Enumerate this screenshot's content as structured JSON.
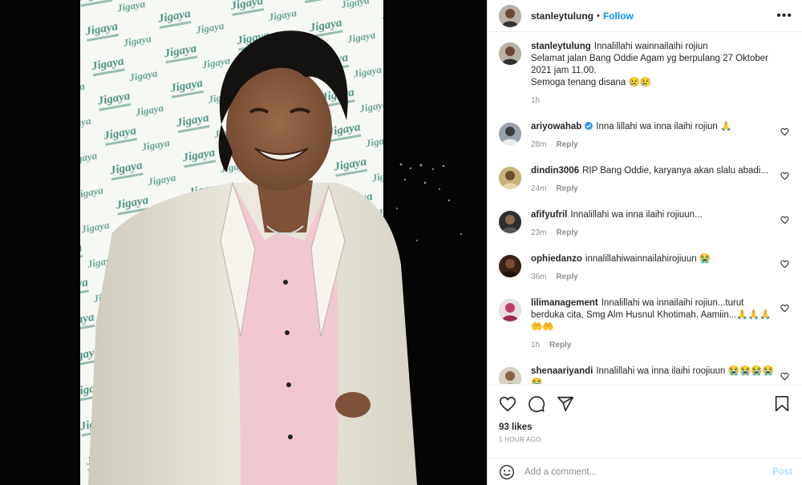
{
  "header": {
    "username": "stanleytulung",
    "separator": "•",
    "follow_label": "Follow",
    "more_label": "•••"
  },
  "caption": {
    "username": "stanleytulung",
    "text": "Innalillahi wainnailaihi rojiun\nSelamat jalan Bang Oddie Agam yg berpulang 27 Oktober 2021 jam 11.00.\nSemoga tenang disana 😢😢",
    "time": "1h"
  },
  "comments": [
    {
      "username": "ariyowahab",
      "verified": true,
      "text": "Inna lillahi wa inna ilaihi rojiun 🙏",
      "time": "28m",
      "reply": "Reply"
    },
    {
      "username": "dindin3006",
      "text": "RIP Bang Oddie, karyanya akan slalu abadi...",
      "time": "24m",
      "reply": "Reply"
    },
    {
      "username": "afifyufril",
      "text": "Innalillahi wa inna ilaihi rojiuun...",
      "time": "23m",
      "reply": "Reply"
    },
    {
      "username": "ophiedanzo",
      "text": "innalillahiwainnailahirojiuun 😭",
      "time": "36m",
      "reply": "Reply"
    },
    {
      "username": "lilimanagement",
      "text": "Innalillahi wa innailaihi rojiun...turut berduka cita, Smg Alm Husnul Khotimah. Aamiin...🙏🙏🙏🤲🤲",
      "time": "1h",
      "reply": "Reply"
    },
    {
      "username": "shenaariyandi",
      "text": "Innalillahi wa inna ilaihi roojiuun 😭😭😭😭😭",
      "time": "",
      "reply": ""
    }
  ],
  "likes": "93 likes",
  "posted_ago": "1 HOUR AGO",
  "add_comment": {
    "placeholder": "Add a comment...",
    "post_label": "Post"
  },
  "icons": [
    "heart-icon",
    "comment-icon",
    "share-icon",
    "save-icon",
    "smile-icon",
    "more-icon",
    "verified-icon"
  ],
  "colors": {
    "accent": "#0095f6",
    "post_disabled": "#b2dffc",
    "jacket": "#e6e2d6",
    "shirt": "#f0c6d0"
  }
}
